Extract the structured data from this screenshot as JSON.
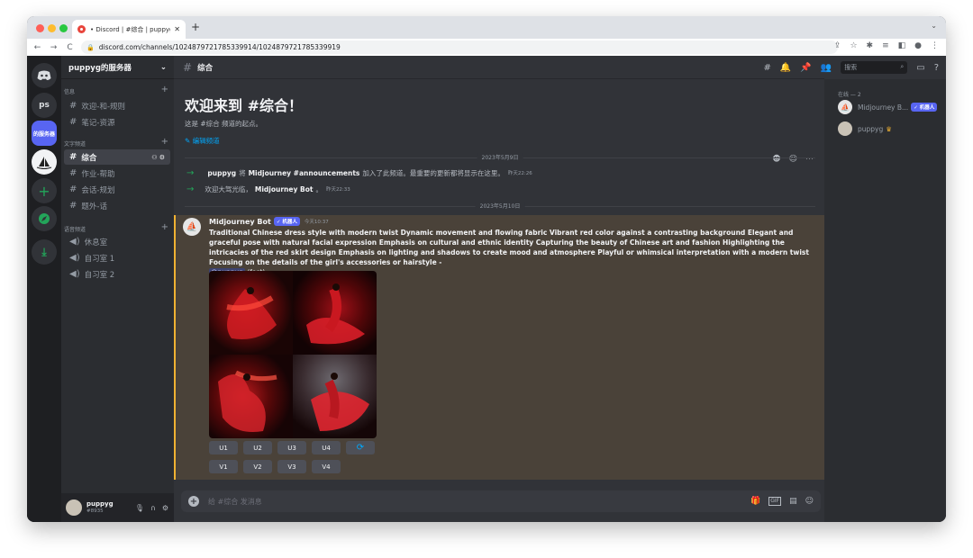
{
  "browser": {
    "tab_title": "• Discord | #综合 | puppyg的服",
    "new_tab": "+",
    "url": "discord.com/channels/1024879721785339914/1024879721785339919"
  },
  "guilds": {
    "items": [
      {
        "label": "ps"
      },
      {
        "label": "的服务器"
      }
    ]
  },
  "server": {
    "name": "puppyg的服务器",
    "categories": [
      {
        "label": "信息",
        "channels": [
          "欢迎-和-规则",
          "笔记-资源"
        ]
      },
      {
        "label": "文字频道",
        "channels": [
          "综合",
          "作业-帮助",
          "会话-规划",
          "题外-话"
        ]
      },
      {
        "label": "语音频道",
        "channels": [
          "休息室",
          "自习室 1",
          "自习室 2"
        ]
      }
    ]
  },
  "user": {
    "name": "puppyg",
    "tag": "#8935"
  },
  "channel": {
    "name": "综合",
    "welcome_title": "欢迎来到 #综合！",
    "welcome_sub": "这是 #综合 频道的起点。",
    "edit_label": "编辑频道"
  },
  "dividers": [
    "2023年5月9日",
    "2023年5月10日"
  ],
  "system_messages": [
    {
      "user": "puppyg",
      "pre": "将",
      "target": "Midjourney #announcements",
      "post": "加入了此频道。最重要的更新都将显示在这里。",
      "time": "昨天22:26"
    },
    {
      "pre": "欢迎大驾光临，",
      "user": "Midjourney Bot",
      "post": "。",
      "time": "昨天22:33"
    }
  ],
  "message": {
    "author": "Midjourney Bot",
    "badge": "✓ 机器人",
    "time": "今天10:37",
    "prompt": "Traditional Chinese dress style with modern twist Dynamic movement and flowing fabric Vibrant red color against a contrasting background Elegant and graceful pose with natural facial expression Emphasis on cultural and ethnic identity Capturing the beauty of Chinese art and fashion Highlighting the intricacies of the red skirt design Emphasis on lighting and shadows to create mood and atmosphere Playful or whimsical interpretation with a modern twist Focusing on the details of the girl's accessories or hairstyle -",
    "mention": "@puppyg",
    "speed": "(fast)",
    "upscale_buttons": [
      "U1",
      "U2",
      "U3",
      "U4"
    ],
    "variation_buttons": [
      "V1",
      "V2",
      "V3",
      "V4"
    ],
    "refresh_icon": "refresh-icon"
  },
  "composer": {
    "placeholder": "给 #综合 发消息"
  },
  "members": {
    "header": "在线 — 2",
    "list": [
      {
        "name": "Midjourney B...",
        "badge": "✓ 机器人"
      },
      {
        "name": "puppyg",
        "crown": "♛"
      }
    ]
  },
  "search": {
    "placeholder": "搜索"
  },
  "colors": {
    "accent": "#5865f2",
    "highlight": "#f0b232",
    "green": "#23a55a",
    "link": "#00a8fc"
  }
}
